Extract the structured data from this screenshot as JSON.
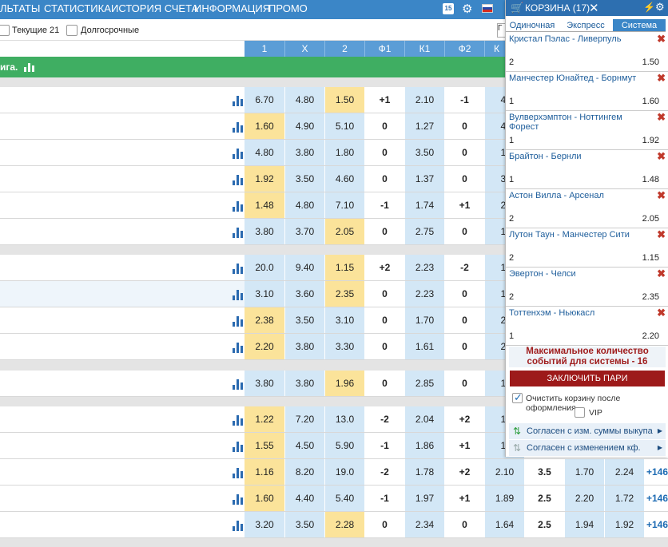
{
  "nav": {
    "items": [
      "ЛЬТАТЫ",
      "СТАТИСТИКА",
      "ИСТОРИЯ СЧЕТА",
      "ИНФОРМАЦИЯ",
      "ПРОМО"
    ],
    "badge": "15"
  },
  "filters": {
    "current_label": "Текущие 21",
    "longterm_label": "Долгосрочные"
  },
  "columns": [
    "1",
    "X",
    "2",
    "Ф1",
    "К1",
    "Ф2",
    "К"
  ],
  "league": {
    "title": "ига."
  },
  "rows": [
    {
      "o1": "6.70",
      "x": "4.80",
      "o2": "1.50",
      "f1": "+1",
      "k1": "2.10",
      "f2": "-1",
      "k": "4.",
      "best": 2
    },
    {
      "o1": "1.60",
      "x": "4.90",
      "o2": "5.10",
      "f1": "0",
      "k1": "1.27",
      "f2": "0",
      "k": "4.",
      "best": 0
    },
    {
      "o1": "4.80",
      "x": "3.80",
      "o2": "1.80",
      "f1": "0",
      "k1": "3.50",
      "f2": "0",
      "k": "1.",
      "best": -1
    },
    {
      "o1": "1.92",
      "x": "3.50",
      "o2": "4.60",
      "f1": "0",
      "k1": "1.37",
      "f2": "0",
      "k": "3.",
      "best": 0
    },
    {
      "o1": "1.48",
      "x": "4.80",
      "o2": "7.10",
      "f1": "-1",
      "k1": "1.74",
      "f2": "+1",
      "k": "2.",
      "best": 0
    },
    {
      "o1": "3.80",
      "x": "3.70",
      "o2": "2.05",
      "f1": "0",
      "k1": "2.75",
      "f2": "0",
      "k": "1.",
      "best": 2
    },
    {
      "o1": "20.0",
      "x": "9.40",
      "o2": "1.15",
      "f1": "+2",
      "k1": "2.23",
      "f2": "-2",
      "k": "1.",
      "best": 2
    },
    {
      "o1": "3.10",
      "x": "3.60",
      "o2": "2.35",
      "f1": "0",
      "k1": "2.23",
      "f2": "0",
      "k": "1.",
      "best": 2
    },
    {
      "o1": "2.38",
      "x": "3.50",
      "o2": "3.10",
      "f1": "0",
      "k1": "1.70",
      "f2": "0",
      "k": "2.",
      "best": 0
    },
    {
      "o1": "2.20",
      "x": "3.80",
      "o2": "3.30",
      "f1": "0",
      "k1": "1.61",
      "f2": "0",
      "k": "2.",
      "best": 0
    },
    {
      "o1": "3.80",
      "x": "3.80",
      "o2": "1.96",
      "f1": "0",
      "k1": "2.85",
      "f2": "0",
      "k": "1.",
      "best": 2
    },
    {
      "o1": "1.22",
      "x": "7.20",
      "o2": "13.0",
      "f1": "-2",
      "k1": "2.04",
      "f2": "+2",
      "k": "1.",
      "best": 0
    },
    {
      "o1": "1.55",
      "x": "4.50",
      "o2": "5.90",
      "f1": "-1",
      "k1": "1.86",
      "f2": "+1",
      "k": "1.",
      "best": 0
    },
    {
      "o1": "1.16",
      "x": "8.20",
      "o2": "19.0",
      "f1": "-2",
      "k1": "1.78",
      "f2": "+2",
      "k": "2.10",
      "t": "3.5",
      "u": "1.70",
      "ov": "2.24",
      "more": "+146",
      "best": 0
    },
    {
      "o1": "1.60",
      "x": "4.40",
      "o2": "5.40",
      "f1": "-1",
      "k1": "1.97",
      "f2": "+1",
      "k": "1.89",
      "t": "2.5",
      "u": "2.20",
      "ov": "1.72",
      "more": "+146",
      "best": 0
    },
    {
      "o1": "3.20",
      "x": "3.50",
      "o2": "2.28",
      "f1": "0",
      "k1": "2.34",
      "f2": "0",
      "k": "1.64",
      "t": "2.5",
      "u": "1.94",
      "ov": "1.92",
      "more": "+146",
      "best": 2
    }
  ],
  "coupon": {
    "title": "КОРЗИНА (17)",
    "tabs": [
      "Одиночная",
      "Экспресс",
      "Система"
    ],
    "items": [
      {
        "name": "Кристал Пэлас - Ливерпуль",
        "outcome": "2",
        "odd": "1.50"
      },
      {
        "name": "Манчестер Юнайтед - Борнмут",
        "outcome": "1",
        "odd": "1.60"
      },
      {
        "name": "Вулверхэмптон - Ноттингем Форест",
        "outcome": "1",
        "odd": "1.92"
      },
      {
        "name": "Брайтон - Бернли",
        "outcome": "1",
        "odd": "1.48"
      },
      {
        "name": "Астон Вилла - Арсенал",
        "outcome": "2",
        "odd": "2.05"
      },
      {
        "name": "Лутон Таун - Манчестер Сити",
        "outcome": "2",
        "odd": "1.15"
      },
      {
        "name": "Эвертон - Челси",
        "outcome": "2",
        "odd": "2.35"
      },
      {
        "name": "Тоттенхэм - Ньюкасл",
        "outcome": "1",
        "odd": "2.20"
      }
    ],
    "max_message": "Максимальное количество событий для системы - 16",
    "place_bet": "ЗАКЛЮЧИТЬ ПАРИ",
    "clear_after": "Очистить корзину после оформления",
    "vip": "VIP",
    "agree_cashout": "Согласен с изм. суммы выкупа",
    "agree_odds": "Согласен с изменением кф."
  },
  "colors": {
    "nav": "#3b86c7",
    "league": "#3fae62",
    "odd_cell": "#d3e7f6",
    "best_cell": "#fbe39a",
    "place_btn": "#9d1a1a"
  }
}
